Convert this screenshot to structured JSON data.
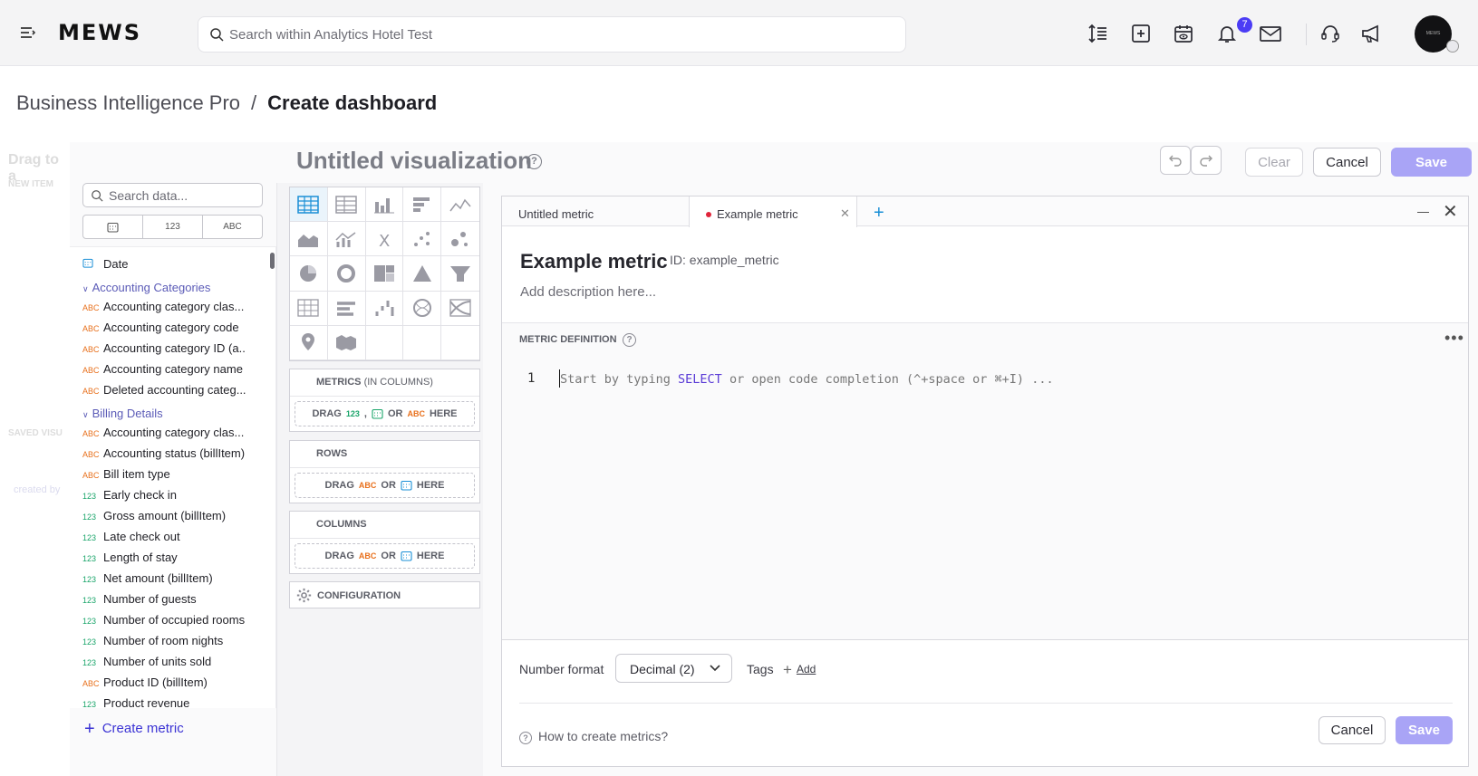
{
  "header": {
    "logo": "MEWS",
    "search_placeholder": "Search within Analytics Hotel Test",
    "notification_count": "7",
    "avatar_text": "MEWS"
  },
  "breadcrumb": {
    "parent": "Business Intelligence Pro",
    "separator": "/",
    "current": "Create dashboard"
  },
  "background_panel": {
    "drag_text": "Drag to a",
    "new_item": "NEW ITEM",
    "saved": "SAVED VISU",
    "created_by": "created by"
  },
  "visualization": {
    "title": "Untitled visualization",
    "clear_label": "Clear",
    "cancel_label": "Cancel",
    "save_label": "Save"
  },
  "data_panel": {
    "search_placeholder": "Search data...",
    "filter_tabs": [
      "",
      "123",
      "ABC"
    ],
    "items": [
      {
        "type": "date",
        "label": "Date"
      },
      {
        "type": "group",
        "label": "Accounting Categories"
      },
      {
        "type": "abc",
        "label": "Accounting category clas..."
      },
      {
        "type": "abc",
        "label": "Accounting category code"
      },
      {
        "type": "abc",
        "label": "Accounting category ID (a..."
      },
      {
        "type": "abc",
        "label": "Accounting category name"
      },
      {
        "type": "abc",
        "label": "Deleted accounting categ..."
      },
      {
        "type": "group",
        "label": "Billing Details"
      },
      {
        "type": "abc",
        "label": "Accounting category clas..."
      },
      {
        "type": "abc",
        "label": "Accounting status (billItem)"
      },
      {
        "type": "abc",
        "label": "Bill item type"
      },
      {
        "type": "num",
        "label": "Early check in"
      },
      {
        "type": "num",
        "label": "Gross amount (billItem)"
      },
      {
        "type": "num",
        "label": "Late check out"
      },
      {
        "type": "num",
        "label": "Length of stay"
      },
      {
        "type": "num",
        "label": "Net amount (billItem)"
      },
      {
        "type": "num",
        "label": "Number of guests"
      },
      {
        "type": "num",
        "label": "Number of occupied rooms"
      },
      {
        "type": "num",
        "label": "Number of room nights"
      },
      {
        "type": "num",
        "label": "Number of units sold"
      },
      {
        "type": "abc",
        "label": "Product ID (billItem)"
      },
      {
        "type": "num",
        "label": "Product revenue"
      }
    ],
    "type_labels": {
      "abc": "ABC",
      "num": "123"
    },
    "create_metric": "Create metric"
  },
  "buckets": {
    "metrics_title": "METRICS",
    "metrics_sub": "(IN COLUMNS)",
    "rows_title": "ROWS",
    "columns_title": "COLUMNS",
    "drag": "DRAG",
    "or": "OR",
    "here": "HERE",
    "comma": ",",
    "configuration": "CONFIGURATION"
  },
  "editor": {
    "tabs": [
      {
        "label": "Untitled metric"
      },
      {
        "label": "Example metric"
      }
    ],
    "metric_title": "Example metric",
    "metric_id": "ID: example_metric",
    "description_placeholder": "Add description here...",
    "definition_label": "METRIC DEFINITION",
    "line_number": "1",
    "code_pre": "Start by typing ",
    "code_kw": "SELECT",
    "code_post": " or open code completion (^+space or ⌘+I) ...",
    "number_format_label": "Number format",
    "number_format_value": "Decimal (2)",
    "tags_label": "Tags",
    "tags_add": "Add",
    "help_link": "How to create metrics?",
    "cancel_label": "Cancel",
    "save_label": "Save"
  },
  "colors": {
    "accent": "#3b33d4",
    "save_disabled": "#a9a4f6",
    "abc": "#e8701c",
    "num": "#1aa56a",
    "badge": "#4b3cf5"
  }
}
